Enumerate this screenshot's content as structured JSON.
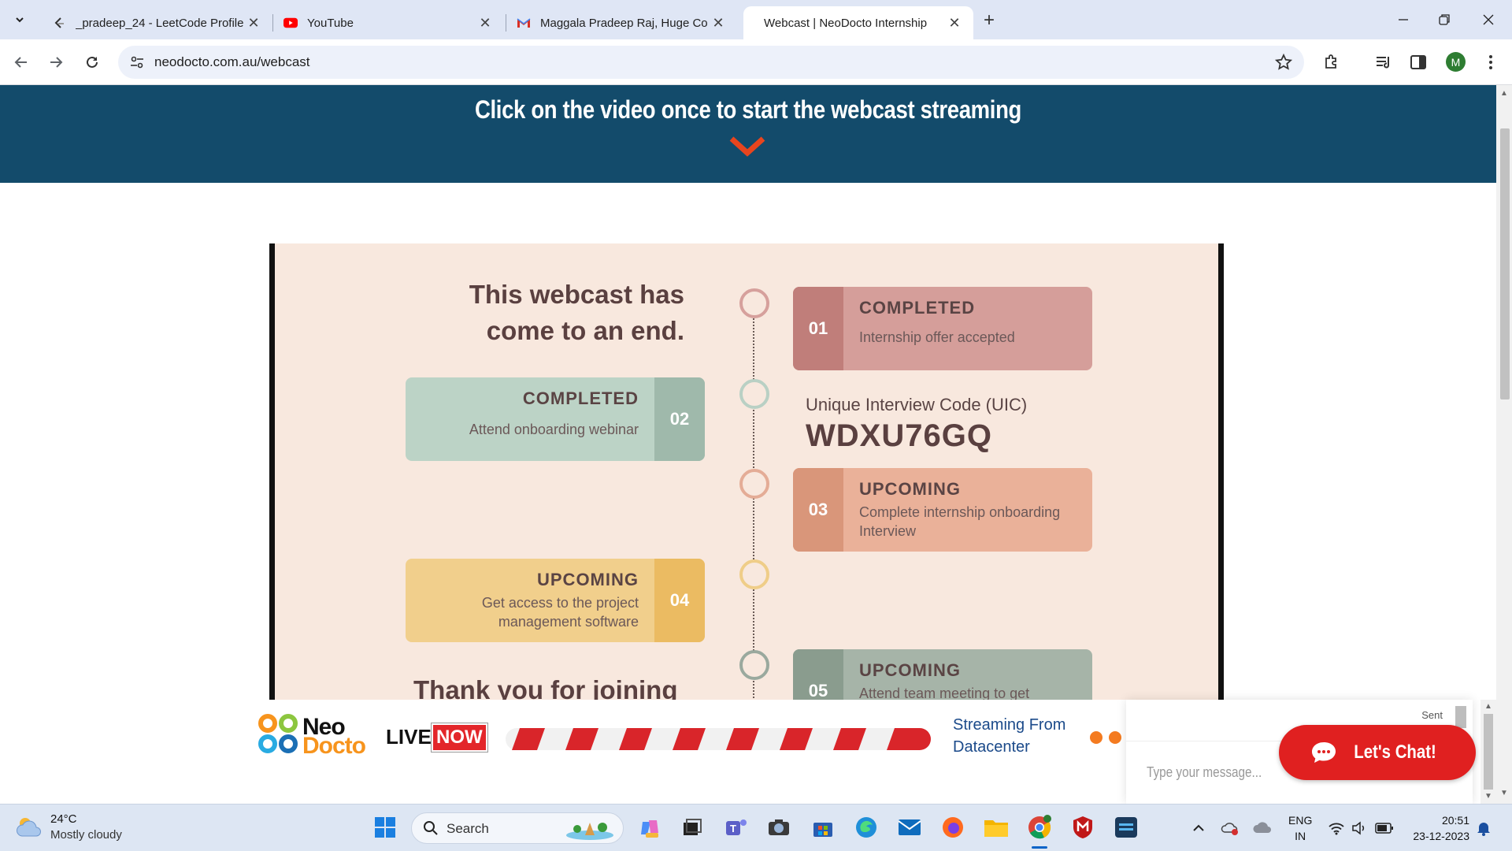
{
  "browser": {
    "tabs": [
      {
        "title": "_pradeep_24 - LeetCode Profile",
        "icon": "leetcode-icon",
        "active": false
      },
      {
        "title": "YouTube",
        "icon": "youtube-icon",
        "active": false
      },
      {
        "title": "Maggala Pradeep Raj, Huge Co",
        "icon": "gmail-icon",
        "active": false
      },
      {
        "title": "Webcast | NeoDocto Internship",
        "icon": "neodocto-icon",
        "active": true
      }
    ],
    "url": "neodocto.com.au/webcast",
    "profile_initial": "M",
    "accent": "#dfe6f5"
  },
  "page": {
    "banner_text": "Click on the video once to start the webcast streaming",
    "banner_color": "#134b6b",
    "chevron_color": "#e8451e",
    "video": {
      "title": "This webcast has come to an end.",
      "thank_you": "Thank you for joining",
      "uic_label": "Unique Interview Code (UIC)",
      "uic_code": "WDXU76GQ",
      "steps": [
        {
          "number": "01",
          "status": "COMPLETED",
          "description": "Internship offer accepted",
          "color": "#d59e9a",
          "num_color": "#c07e7a"
        },
        {
          "number": "02",
          "status": "COMPLETED",
          "description": "Attend onboarding webinar",
          "color": "#bcd3c6",
          "num_color": "#9fb9ab"
        },
        {
          "number": "03",
          "status": "UPCOMING",
          "description": "Complete internship onboarding Interview",
          "color": "#eab199",
          "num_color": "#d9967a"
        },
        {
          "number": "04",
          "status": "UPCOMING",
          "description": "Get access to the project management software",
          "color": "#f1cf8c",
          "num_color": "#ebbb62"
        },
        {
          "number": "05",
          "status": "UPCOMING",
          "description": "Attend team meeting to get",
          "color": "#a6b4a8",
          "num_color": "#8a9c8e"
        }
      ]
    },
    "live_strip": {
      "logo_top": "Neo",
      "logo_bottom": "Docto",
      "live": "LIVE",
      "now": "NOW",
      "streaming_line1": "Streaming From",
      "streaming_line2": "Datacenter"
    },
    "chat": {
      "sent": "Sent",
      "placeholder": "Type your message...",
      "button": "Let's Chat!"
    }
  },
  "taskbar": {
    "temperature": "24°C",
    "weather": "Mostly cloudy",
    "search": "Search",
    "lang_line1": "ENG",
    "lang_line2": "IN",
    "time": "20:51",
    "date": "23-12-2023"
  }
}
